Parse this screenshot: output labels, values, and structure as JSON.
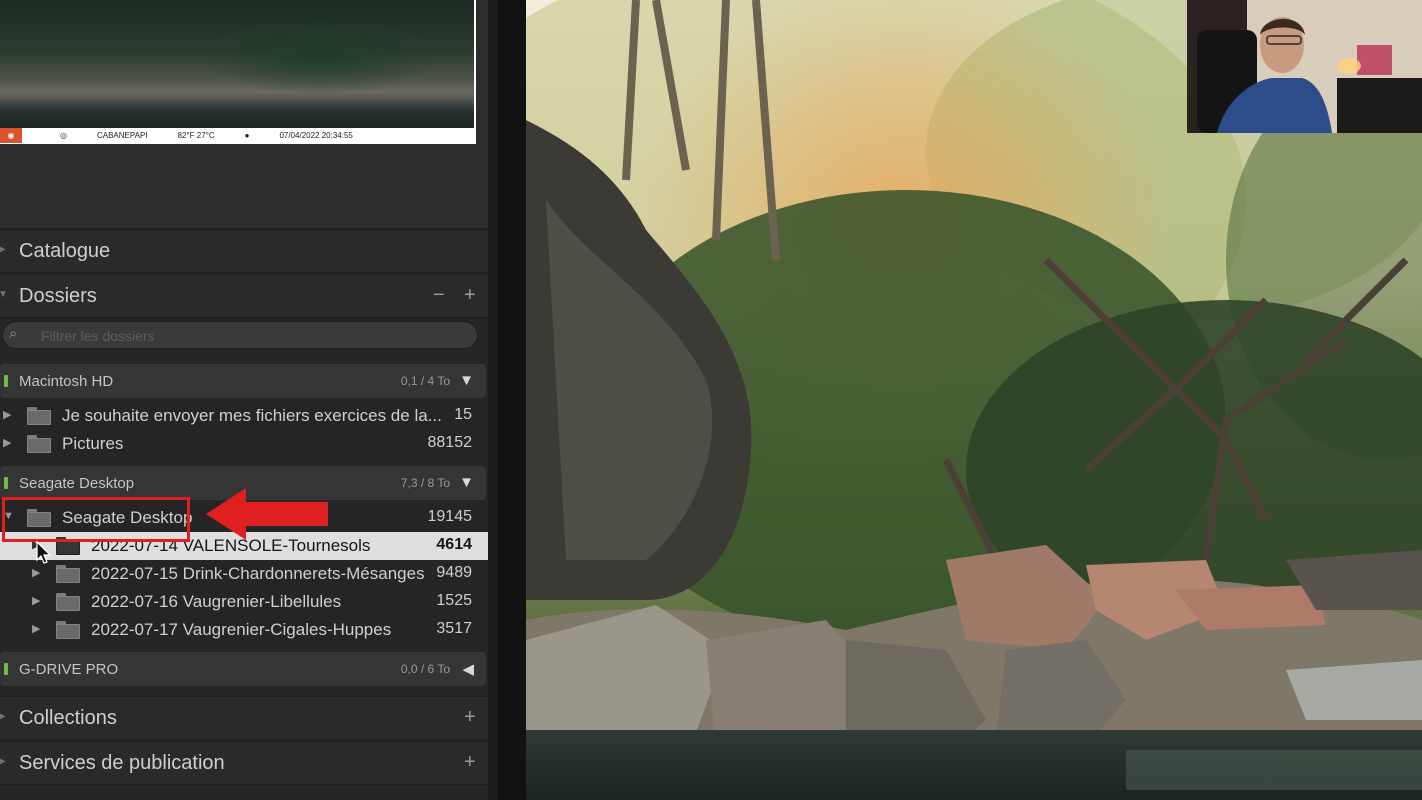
{
  "navigator": {
    "stamp_brand": "Bushnell",
    "stamp_camera": "CABANEPAPI",
    "stamp_temp": "82°F 27°C",
    "stamp_datetime": "07/04/2022 20:34:55"
  },
  "panels": {
    "catalogue": "Catalogue",
    "dossiers": "Dossiers",
    "collections": "Collections",
    "publication": "Services de publication"
  },
  "search": {
    "placeholder": "Filtrer les dossiers"
  },
  "volumes": [
    {
      "name": "Macintosh HD",
      "space": "0,1 / 4 To",
      "chevron": "▼",
      "status_color": "#6fbf49"
    },
    {
      "name": "Seagate Desktop",
      "space": "7,3 / 8 To",
      "chevron": "▼",
      "status_color": "#6fbf49"
    },
    {
      "name": "G-DRIVE PRO",
      "space": "0,0 / 6 To",
      "chevron": "◀",
      "status_color": "#6fbf49"
    }
  ],
  "folders": {
    "macintosh": [
      {
        "label": "Je souhaite envoyer mes fichiers exercices de la...",
        "count": "15"
      },
      {
        "label": "Pictures",
        "count": "88152"
      }
    ],
    "seagate_root": {
      "label": "Seagate Desktop",
      "count": "19145"
    },
    "seagate_children": [
      {
        "label": "2022-07-14 VALENSOLE-Tournesols",
        "count": "4614",
        "selected": true
      },
      {
        "label": "2022-07-15 Drink-Chardonnerets-Mésanges",
        "count": "9489"
      },
      {
        "label": "2022-07-16 Vaugrenier-Libellules",
        "count": "1525"
      },
      {
        "label": "2022-07-17 Vaugrenier-Cigales-Huppes",
        "count": "3517"
      }
    ]
  },
  "icons": {
    "panel_collapsed": "▶",
    "expand": "▶",
    "collapse": "▼",
    "search": "search-icon",
    "minus": "−",
    "plus": "+"
  },
  "accent_colors": {
    "annotation_red": "#e02020",
    "selection": "#dedede"
  }
}
